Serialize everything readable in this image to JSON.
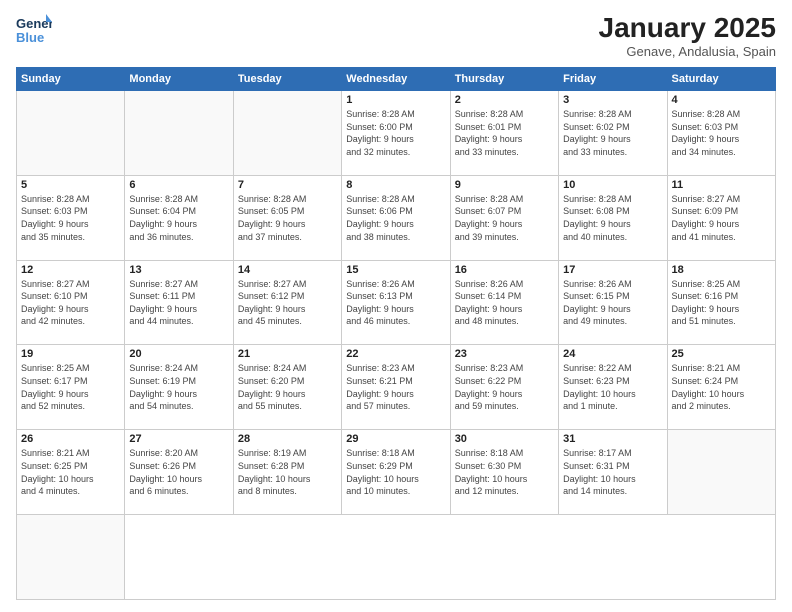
{
  "logo": {
    "line1": "General",
    "line2": "Blue"
  },
  "title": "January 2025",
  "subtitle": "Genave, Andalusia, Spain",
  "weekdays": [
    "Sunday",
    "Monday",
    "Tuesday",
    "Wednesday",
    "Thursday",
    "Friday",
    "Saturday"
  ],
  "days": [
    {
      "num": "",
      "info": ""
    },
    {
      "num": "",
      "info": ""
    },
    {
      "num": "",
      "info": ""
    },
    {
      "num": "1",
      "info": "Sunrise: 8:28 AM\nSunset: 6:00 PM\nDaylight: 9 hours\nand 32 minutes."
    },
    {
      "num": "2",
      "info": "Sunrise: 8:28 AM\nSunset: 6:01 PM\nDaylight: 9 hours\nand 33 minutes."
    },
    {
      "num": "3",
      "info": "Sunrise: 8:28 AM\nSunset: 6:02 PM\nDaylight: 9 hours\nand 33 minutes."
    },
    {
      "num": "4",
      "info": "Sunrise: 8:28 AM\nSunset: 6:03 PM\nDaylight: 9 hours\nand 34 minutes."
    },
    {
      "num": "5",
      "info": "Sunrise: 8:28 AM\nSunset: 6:03 PM\nDaylight: 9 hours\nand 35 minutes."
    },
    {
      "num": "6",
      "info": "Sunrise: 8:28 AM\nSunset: 6:04 PM\nDaylight: 9 hours\nand 36 minutes."
    },
    {
      "num": "7",
      "info": "Sunrise: 8:28 AM\nSunset: 6:05 PM\nDaylight: 9 hours\nand 37 minutes."
    },
    {
      "num": "8",
      "info": "Sunrise: 8:28 AM\nSunset: 6:06 PM\nDaylight: 9 hours\nand 38 minutes."
    },
    {
      "num": "9",
      "info": "Sunrise: 8:28 AM\nSunset: 6:07 PM\nDaylight: 9 hours\nand 39 minutes."
    },
    {
      "num": "10",
      "info": "Sunrise: 8:28 AM\nSunset: 6:08 PM\nDaylight: 9 hours\nand 40 minutes."
    },
    {
      "num": "11",
      "info": "Sunrise: 8:27 AM\nSunset: 6:09 PM\nDaylight: 9 hours\nand 41 minutes."
    },
    {
      "num": "12",
      "info": "Sunrise: 8:27 AM\nSunset: 6:10 PM\nDaylight: 9 hours\nand 42 minutes."
    },
    {
      "num": "13",
      "info": "Sunrise: 8:27 AM\nSunset: 6:11 PM\nDaylight: 9 hours\nand 44 minutes."
    },
    {
      "num": "14",
      "info": "Sunrise: 8:27 AM\nSunset: 6:12 PM\nDaylight: 9 hours\nand 45 minutes."
    },
    {
      "num": "15",
      "info": "Sunrise: 8:26 AM\nSunset: 6:13 PM\nDaylight: 9 hours\nand 46 minutes."
    },
    {
      "num": "16",
      "info": "Sunrise: 8:26 AM\nSunset: 6:14 PM\nDaylight: 9 hours\nand 48 minutes."
    },
    {
      "num": "17",
      "info": "Sunrise: 8:26 AM\nSunset: 6:15 PM\nDaylight: 9 hours\nand 49 minutes."
    },
    {
      "num": "18",
      "info": "Sunrise: 8:25 AM\nSunset: 6:16 PM\nDaylight: 9 hours\nand 51 minutes."
    },
    {
      "num": "19",
      "info": "Sunrise: 8:25 AM\nSunset: 6:17 PM\nDaylight: 9 hours\nand 52 minutes."
    },
    {
      "num": "20",
      "info": "Sunrise: 8:24 AM\nSunset: 6:19 PM\nDaylight: 9 hours\nand 54 minutes."
    },
    {
      "num": "21",
      "info": "Sunrise: 8:24 AM\nSunset: 6:20 PM\nDaylight: 9 hours\nand 55 minutes."
    },
    {
      "num": "22",
      "info": "Sunrise: 8:23 AM\nSunset: 6:21 PM\nDaylight: 9 hours\nand 57 minutes."
    },
    {
      "num": "23",
      "info": "Sunrise: 8:23 AM\nSunset: 6:22 PM\nDaylight: 9 hours\nand 59 minutes."
    },
    {
      "num": "24",
      "info": "Sunrise: 8:22 AM\nSunset: 6:23 PM\nDaylight: 10 hours\nand 1 minute."
    },
    {
      "num": "25",
      "info": "Sunrise: 8:21 AM\nSunset: 6:24 PM\nDaylight: 10 hours\nand 2 minutes."
    },
    {
      "num": "26",
      "info": "Sunrise: 8:21 AM\nSunset: 6:25 PM\nDaylight: 10 hours\nand 4 minutes."
    },
    {
      "num": "27",
      "info": "Sunrise: 8:20 AM\nSunset: 6:26 PM\nDaylight: 10 hours\nand 6 minutes."
    },
    {
      "num": "28",
      "info": "Sunrise: 8:19 AM\nSunset: 6:28 PM\nDaylight: 10 hours\nand 8 minutes."
    },
    {
      "num": "29",
      "info": "Sunrise: 8:18 AM\nSunset: 6:29 PM\nDaylight: 10 hours\nand 10 minutes."
    },
    {
      "num": "30",
      "info": "Sunrise: 8:18 AM\nSunset: 6:30 PM\nDaylight: 10 hours\nand 12 minutes."
    },
    {
      "num": "31",
      "info": "Sunrise: 8:17 AM\nSunset: 6:31 PM\nDaylight: 10 hours\nand 14 minutes."
    },
    {
      "num": "",
      "info": ""
    },
    {
      "num": "",
      "info": ""
    }
  ]
}
